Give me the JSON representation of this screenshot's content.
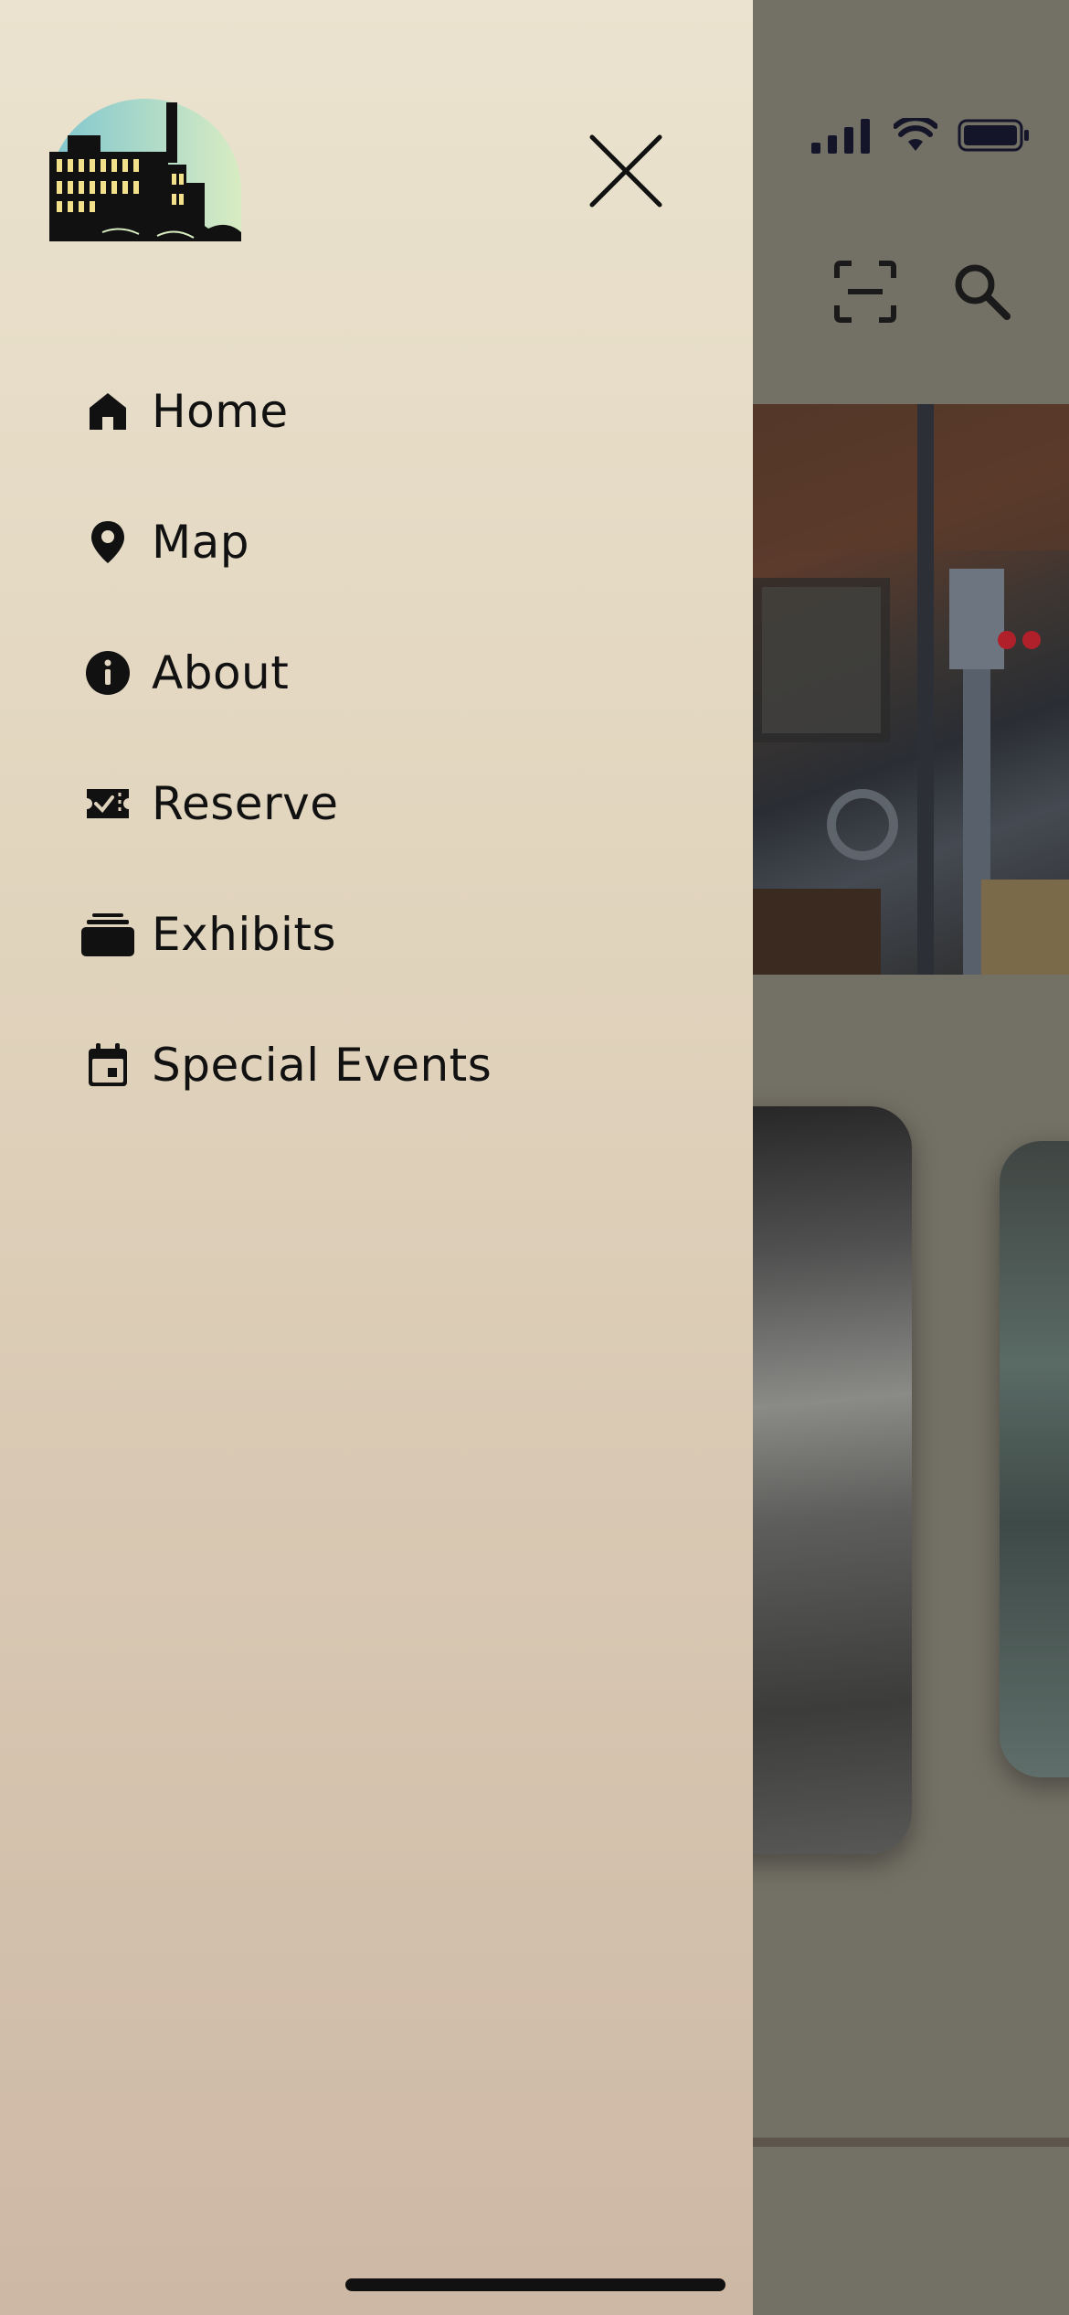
{
  "menu": {
    "items": [
      {
        "label": "Home",
        "icon": "home-icon"
      },
      {
        "label": "Map",
        "icon": "map-pin-icon"
      },
      {
        "label": "About",
        "icon": "info-icon"
      },
      {
        "label": "Reserve",
        "icon": "ticket-icon"
      },
      {
        "label": "Exhibits",
        "icon": "stack-icon"
      },
      {
        "label": "Special Events",
        "icon": "calendar-icon"
      }
    ]
  },
  "colors": {
    "drawer_top": "#ebe3cf",
    "drawer_bottom": "#cdb8a5",
    "overlay": "#737065",
    "text": "#111111"
  }
}
